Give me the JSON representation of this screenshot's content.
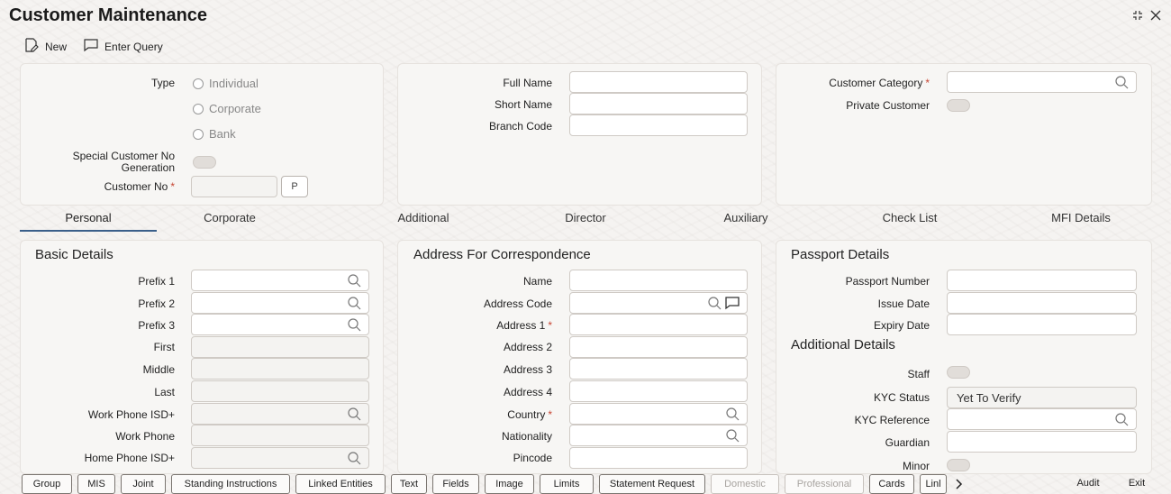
{
  "header": {
    "title": "Customer Maintenance"
  },
  "toolbar": {
    "new_label": "New",
    "enter_query_label": "Enter Query"
  },
  "top_left": {
    "type_label": "Type",
    "type_options": [
      "Individual",
      "Corporate",
      "Bank"
    ],
    "special_label_1": "Special Customer No",
    "special_label_2": "Generation",
    "customer_no_label": "Customer No",
    "p_button": "P"
  },
  "top_mid": {
    "full_name_label": "Full Name",
    "short_name_label": "Short Name",
    "branch_code_label": "Branch Code"
  },
  "top_right": {
    "customer_category_label": "Customer Category",
    "private_customer_label": "Private Customer"
  },
  "tabs": [
    "Personal",
    "Corporate",
    "Additional",
    "Director",
    "Auxiliary",
    "Check List",
    "MFI Details"
  ],
  "basic": {
    "title": "Basic Details",
    "labels": [
      "Prefix 1",
      "Prefix 2",
      "Prefix 3",
      "First",
      "Middle",
      "Last",
      "Work Phone ISD+",
      "Work Phone",
      "Home Phone ISD+"
    ]
  },
  "address": {
    "title": "Address For Correspondence",
    "labels": [
      "Name",
      "Address Code",
      "Address 1",
      "Address 2",
      "Address 3",
      "Address 4",
      "Country",
      "Nationality",
      "Pincode"
    ]
  },
  "passport": {
    "title": "Passport Details",
    "labels": [
      "Passport Number",
      "Issue Date",
      "Expiry Date"
    ]
  },
  "additional": {
    "title": "Additional Details",
    "staff_label": "Staff",
    "kyc_status_label": "KYC Status",
    "kyc_status_value": "Yet To Verify",
    "kyc_reference_label": "KYC Reference",
    "guardian_label": "Guardian",
    "minor_label": "Minor"
  },
  "bottom_buttons": [
    "Group",
    "MIS",
    "Joint",
    "Standing Instructions",
    "Linked Entities",
    "Text",
    "Fields",
    "Image",
    "Limits",
    "Statement Request",
    "Domestic",
    "Professional",
    "Cards",
    "Linl"
  ],
  "audit_label": "Audit",
  "exit_label": "Exit"
}
